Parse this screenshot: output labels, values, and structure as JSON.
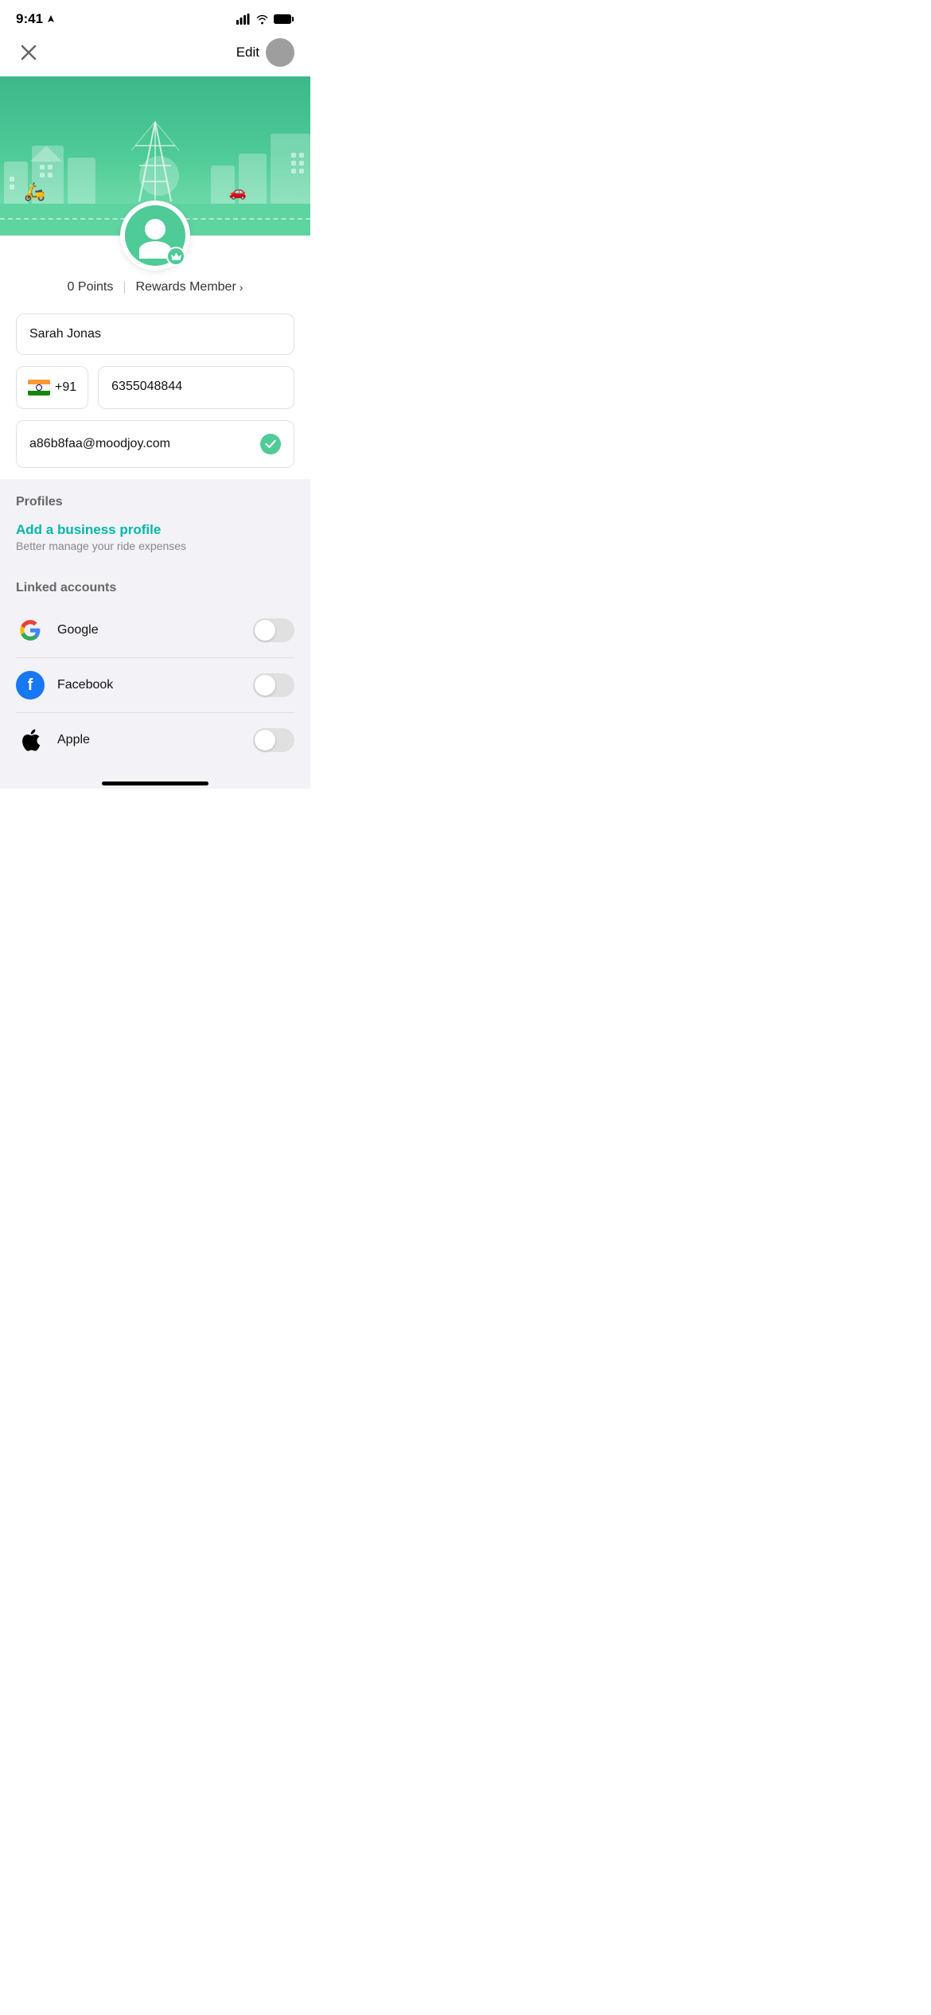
{
  "status": {
    "time": "9:41",
    "signal": "signal",
    "wifi": "wifi",
    "battery": "battery"
  },
  "nav": {
    "close_label": "×",
    "edit_label": "Edit"
  },
  "profile": {
    "points_label": "0 Points",
    "divider": "|",
    "rewards_label": "Rewards Member",
    "chevron": "›"
  },
  "form": {
    "name_value": "Sarah Jonas",
    "country_code": "+91",
    "phone_value": "6355048844",
    "email_value": "a86b8faa@moodjoy.com"
  },
  "profiles_section": {
    "title": "Profiles",
    "add_business_title": "Add a business profile",
    "add_business_sub": "Better manage your ride expenses"
  },
  "linked_accounts": {
    "title": "Linked accounts",
    "items": [
      {
        "name": "Google",
        "icon_type": "google",
        "enabled": false
      },
      {
        "name": "Facebook",
        "icon_type": "facebook",
        "enabled": false
      },
      {
        "name": "Apple",
        "icon_type": "apple",
        "enabled": false
      }
    ]
  },
  "colors": {
    "primary_green": "#4ecb96",
    "teal": "#3cb88a",
    "blue": "#00b8a9",
    "facebook_blue": "#1877f2"
  }
}
